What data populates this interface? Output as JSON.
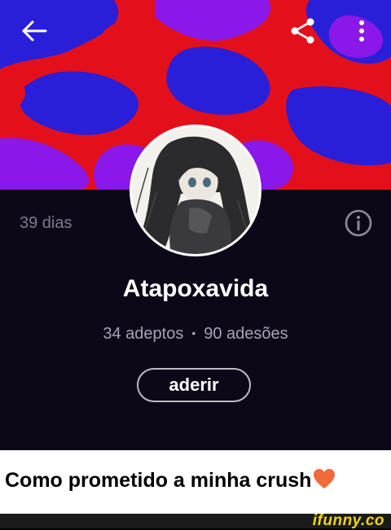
{
  "profile": {
    "duration": "39 dias",
    "name": "Atapoxavida",
    "followers": "34 adeptos",
    "separator": "•",
    "joins": "90 adesões",
    "join_label": "aderir"
  },
  "icons": {
    "back": "arrow-left-icon",
    "share": "share-icon",
    "more": "more-vertical-icon",
    "info": "info-icon"
  },
  "caption": {
    "text": "Como prometido a minha crush"
  },
  "watermark": {
    "text": "ifunny.co"
  },
  "colors": {
    "banner_red": "#e3101c",
    "banner_blue": "#2a1fd8",
    "banner_purple": "#8a18e8",
    "app_background": "#0d0818",
    "heart": "#f06a3a",
    "brand": "#f1d413"
  }
}
